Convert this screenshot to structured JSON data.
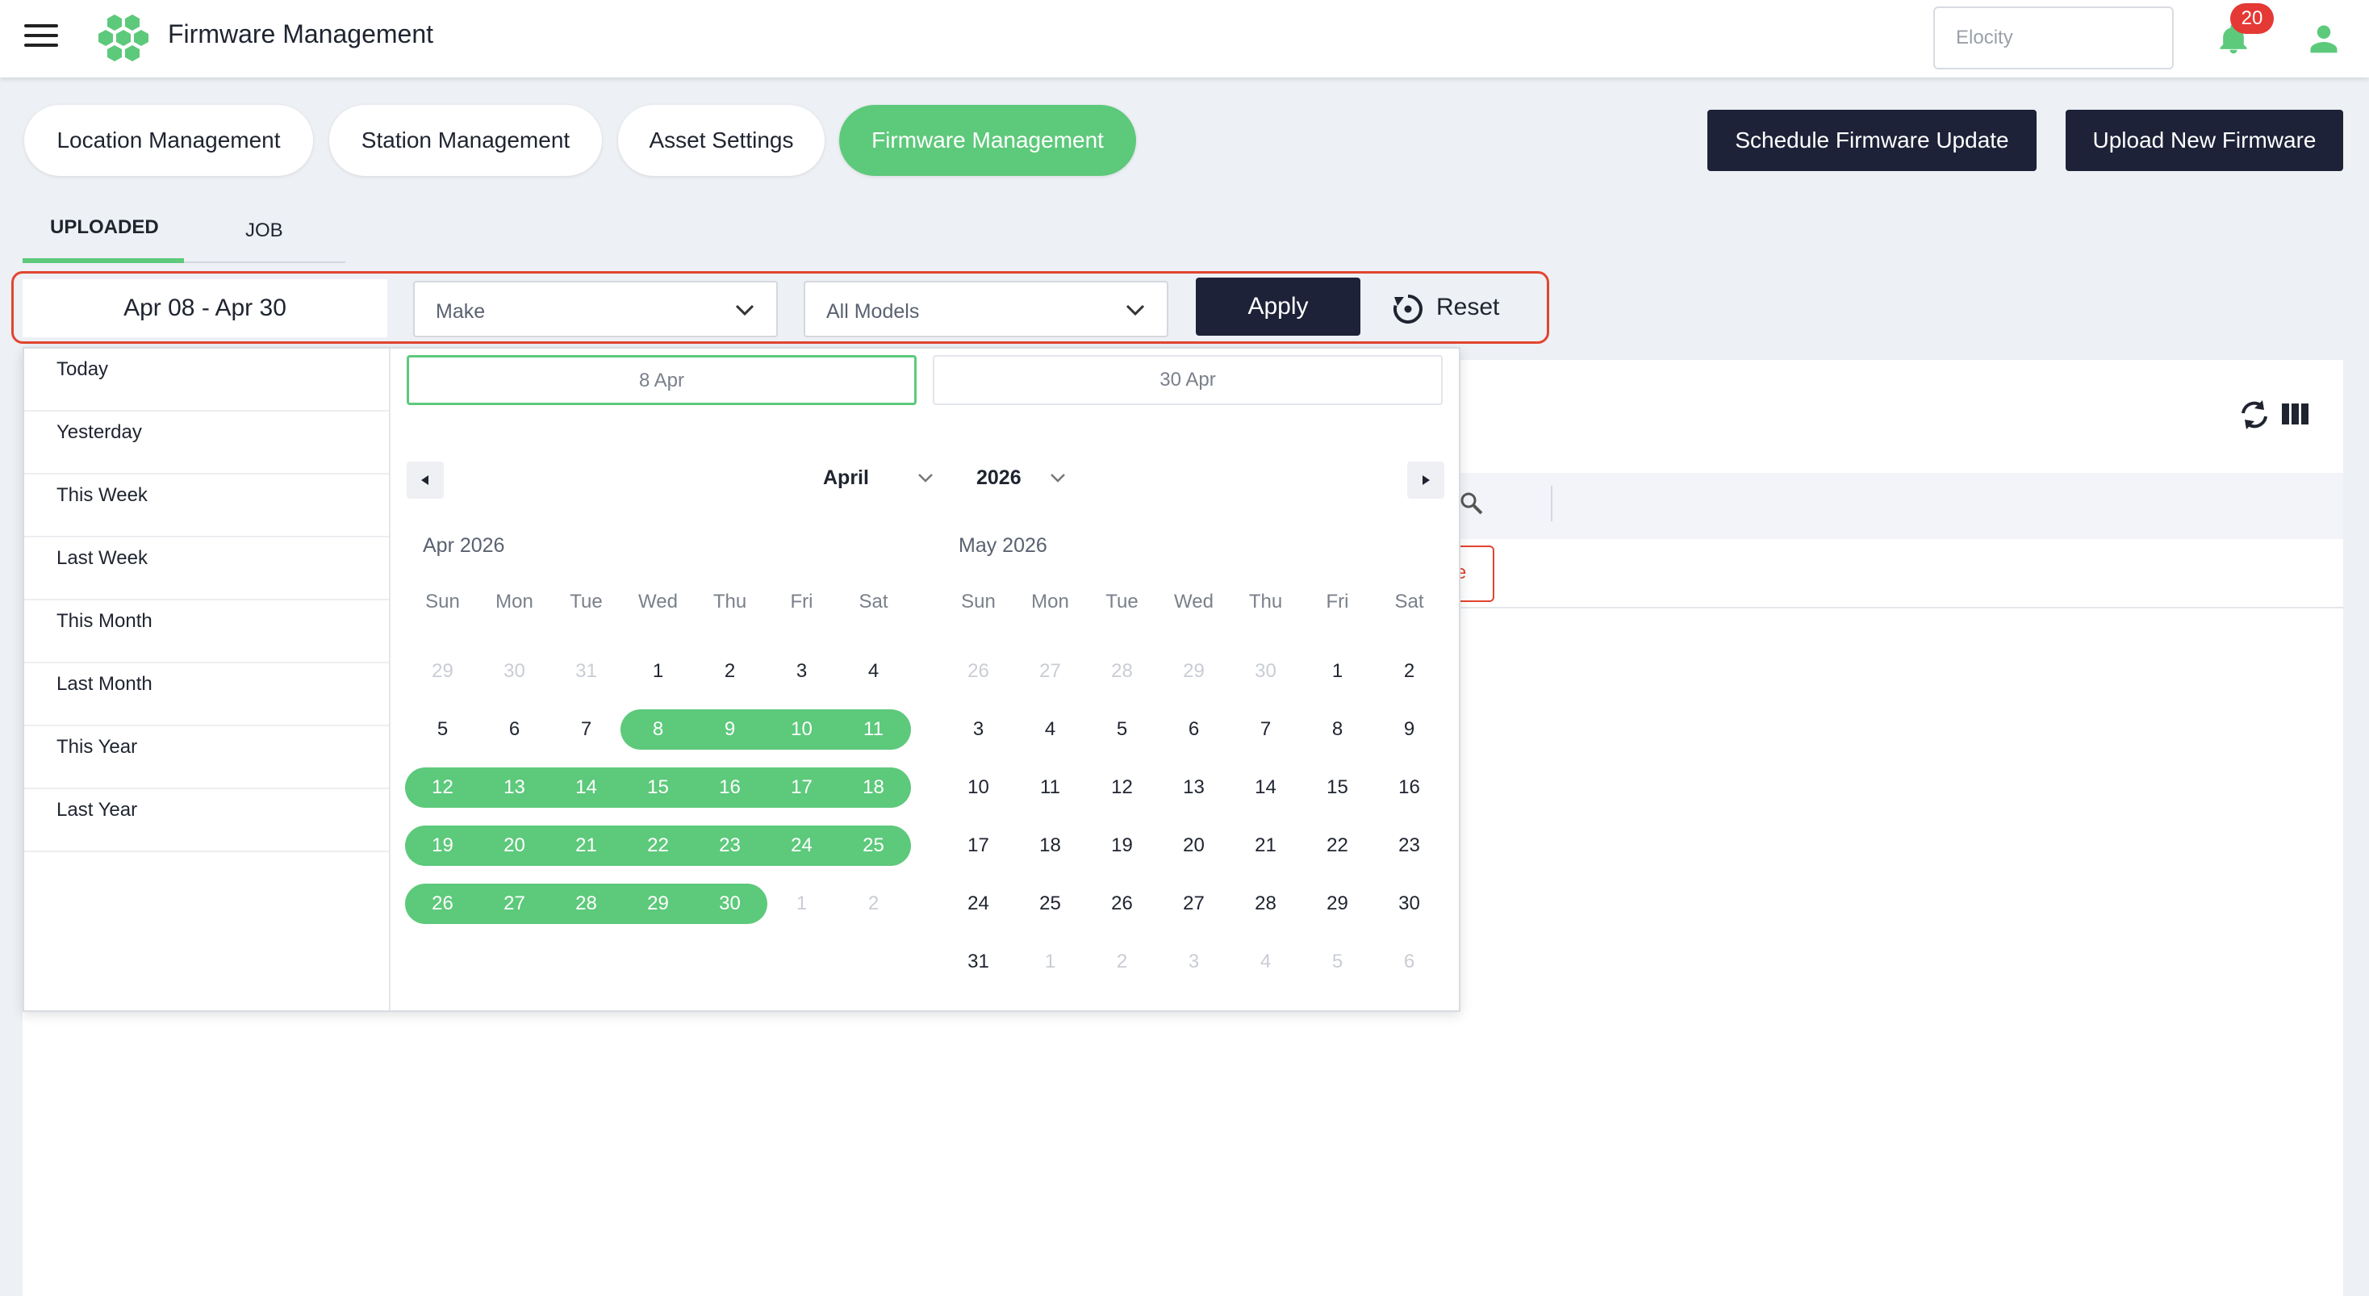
{
  "header": {
    "title": "Firmware Management",
    "tenant_placeholder": "Elocity",
    "notifications_count": "20"
  },
  "modules": [
    {
      "label": "Location Management"
    },
    {
      "label": "Station Management"
    },
    {
      "label": "Asset Settings"
    },
    {
      "label": "Firmware Management",
      "active": true
    }
  ],
  "actions": {
    "schedule_label": "Schedule Firmware Update",
    "upload_label": "Upload New Firmware"
  },
  "tabs": [
    {
      "label": "UPLOADED",
      "active": true
    },
    {
      "label": "JOB"
    }
  ],
  "filters": {
    "date_range": "Apr 08 - Apr 30",
    "make_placeholder": "Make",
    "models_placeholder": "All Models",
    "apply_label": "Apply",
    "reset_label": "Reset"
  },
  "picker": {
    "presets": [
      "Today",
      "Yesterday",
      "This Week",
      "Last Week",
      "This Month",
      "Last Month",
      "This Year",
      "Last Year"
    ],
    "start_input": "8 Apr",
    "end_input": "30 Apr",
    "month_select": "April",
    "year_select": "2026",
    "weekdays": [
      "Sun",
      "Mon",
      "Tue",
      "Wed",
      "Thu",
      "Fri",
      "Sat"
    ],
    "calendars": [
      {
        "title": "Apr 2026",
        "weeks": [
          [
            "29",
            "30",
            "31",
            "1",
            "2",
            "3",
            "4"
          ],
          [
            "5",
            "6",
            "7",
            "8",
            "9",
            "10",
            "11"
          ],
          [
            "12",
            "13",
            "14",
            "15",
            "16",
            "17",
            "18"
          ],
          [
            "19",
            "20",
            "21",
            "22",
            "23",
            "24",
            "25"
          ],
          [
            "26",
            "27",
            "28",
            "29",
            "30",
            "1",
            "2"
          ]
        ],
        "muted": [
          [
            0,
            0
          ],
          [
            0,
            1
          ],
          [
            0,
            2
          ],
          [
            4,
            5
          ],
          [
            4,
            6
          ]
        ],
        "range": [
          [
            1,
            3
          ],
          [
            1,
            4
          ],
          [
            1,
            5
          ],
          [
            1,
            6
          ],
          [
            2,
            0
          ],
          [
            2,
            1
          ],
          [
            2,
            2
          ],
          [
            2,
            3
          ],
          [
            2,
            4
          ],
          [
            2,
            5
          ],
          [
            2,
            6
          ],
          [
            3,
            0
          ],
          [
            3,
            1
          ],
          [
            3,
            2
          ],
          [
            3,
            3
          ],
          [
            3,
            4
          ],
          [
            3,
            5
          ],
          [
            3,
            6
          ],
          [
            4,
            0
          ],
          [
            4,
            1
          ],
          [
            4,
            2
          ],
          [
            4,
            3
          ],
          [
            4,
            4
          ]
        ]
      },
      {
        "title": "May 2026",
        "weeks": [
          [
            "26",
            "27",
            "28",
            "29",
            "30",
            "1",
            "2"
          ],
          [
            "3",
            "4",
            "5",
            "6",
            "7",
            "8",
            "9"
          ],
          [
            "10",
            "11",
            "12",
            "13",
            "14",
            "15",
            "16"
          ],
          [
            "17",
            "18",
            "19",
            "20",
            "21",
            "22",
            "23"
          ],
          [
            "24",
            "25",
            "26",
            "27",
            "28",
            "29",
            "30"
          ],
          [
            "31",
            "1",
            "2",
            "3",
            "4",
            "5",
            "6"
          ]
        ],
        "muted": [
          [
            0,
            0
          ],
          [
            0,
            1
          ],
          [
            0,
            2
          ],
          [
            0,
            3
          ],
          [
            0,
            4
          ],
          [
            5,
            1
          ],
          [
            5,
            2
          ],
          [
            5,
            3
          ],
          [
            5,
            4
          ],
          [
            5,
            5
          ],
          [
            5,
            6
          ]
        ],
        "range": []
      }
    ]
  },
  "table": {
    "chip_text": "e"
  },
  "colors": {
    "accent": "#5dc97b",
    "dark": "#1e2238",
    "alert": "#e53935",
    "outline": "#e2452f"
  },
  "icons": [
    "menu-icon",
    "logo-icon",
    "bell-icon",
    "user-icon",
    "chevron-down-icon",
    "reset-icon",
    "refresh-icon",
    "columns-icon",
    "search-icon",
    "caret-left-icon",
    "caret-right-icon"
  ]
}
